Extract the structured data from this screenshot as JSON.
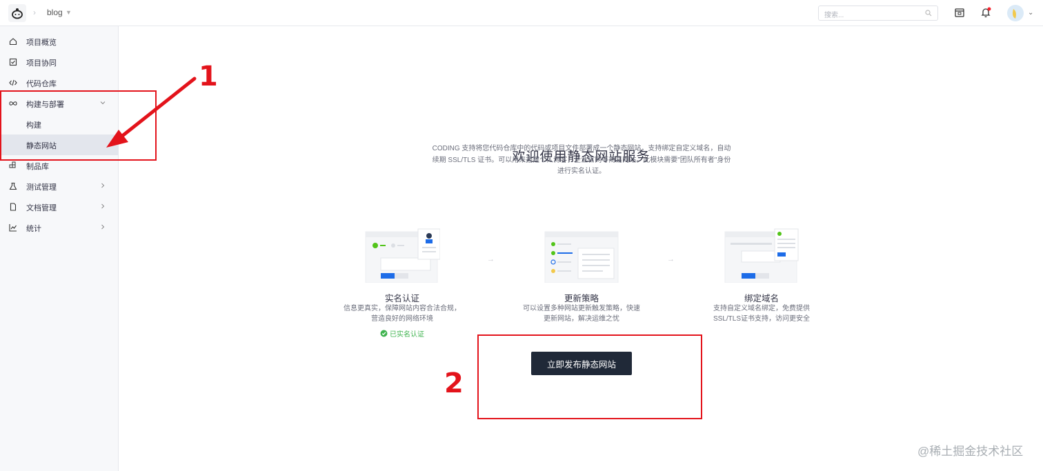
{
  "topbar": {
    "project_name": "blog",
    "search_placeholder": "搜索..."
  },
  "sidebar": {
    "items": [
      {
        "label": "项目概览",
        "icon": "home-icon"
      },
      {
        "label": "项目协同",
        "icon": "checkbox-icon"
      },
      {
        "label": "代码仓库",
        "icon": "code-icon"
      },
      {
        "label": "构建与部署",
        "icon": "infinity-icon",
        "expanded": true
      },
      {
        "label": "构建"
      },
      {
        "label": "静态网站",
        "active": true
      },
      {
        "label": "制品库",
        "icon": "package-icon"
      },
      {
        "label": "测试管理",
        "icon": "flask-icon"
      },
      {
        "label": "文档管理",
        "icon": "document-icon"
      },
      {
        "label": "统计",
        "icon": "chart-icon"
      }
    ]
  },
  "main": {
    "title": "欢迎使用静态网站服务",
    "description": "CODING 支持将您代码仓库中的代码或项目文件部署成一个静态网站，支持绑定自定义域名，自动续期 SSL/TLS 证书。可以用来搭建个人博客，企业官网等简易网站。此模块需要\"团队所有者\"身份进行实名认证。",
    "cards": [
      {
        "title": "实名认证",
        "desc": "信息更真实，保障网站内容合法合规，营造良好的网络环境",
        "status": "已实名认证"
      },
      {
        "title": "更新策略",
        "desc": "可以设置多种网站更新触发策略，快速更新网站，解决运维之忧"
      },
      {
        "title": "绑定域名",
        "desc": "支持自定义域名绑定，免费提供SSL/TLS证书支持，访问更安全"
      }
    ],
    "step_arrow": "→",
    "publish_button": "立即发布静态网站"
  },
  "annotations": {
    "label_1": "1",
    "label_2": "2"
  },
  "watermark": "@稀土掘金技术社区",
  "colors": {
    "accent_red": "#e3131b",
    "button_dark": "#202938",
    "success_green": "#3fb34f",
    "sidebar_bg": "#f7f8fa"
  }
}
